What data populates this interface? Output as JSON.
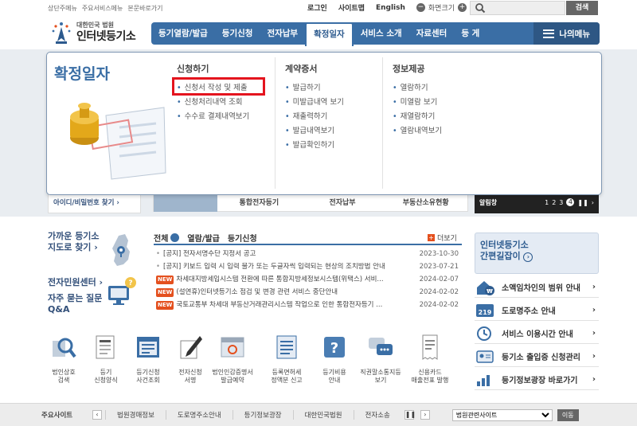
{
  "skip_links": [
    "상단주메뉴",
    "주요서비스메뉴",
    "본문바로가기"
  ],
  "utility": {
    "login": "로그인",
    "sitemap": "사이트맵",
    "english": "English",
    "zoom_label": "화면크기",
    "zoom_minus": "−",
    "zoom_plus": "+"
  },
  "search": {
    "placeholder": "",
    "button": "검색"
  },
  "logo": {
    "small": "대한민국 법원",
    "big": "인터넷등기소"
  },
  "gnb": {
    "items": [
      "등기열람/발급",
      "등기신청",
      "전자납부",
      "확정일자",
      "서비스 소개",
      "자료센터",
      "등 게"
    ],
    "active_index": 3,
    "menu_button": "나의메뉴"
  },
  "dropdown": {
    "title": "확정일자",
    "columns": [
      {
        "heading": "신청하기",
        "items": [
          "신청서 작성 및 제출",
          "신청처리내역 조회",
          "수수료 결제내역보기"
        ]
      },
      {
        "heading": "계약증서",
        "items": [
          "발급하기",
          "미발급내역 보기",
          "재출력하기",
          "발급내역보기",
          "발급확인하기"
        ]
      },
      {
        "heading": "정보제공",
        "items": [
          "열람하기",
          "미열람 보기",
          "재열람하기",
          "열람내역보기"
        ]
      }
    ]
  },
  "background": {
    "login_link": "아이디/비밀번호 찾기 ›",
    "mid_tabs": [
      "통합전자등기",
      "전자납부",
      "부동산소유현황"
    ],
    "banner_label": "알림창",
    "banner_pages": [
      "1",
      "2",
      "3",
      "4"
    ],
    "banner_current": "4",
    "banner_pause": "❚❚",
    "banner_next": "›"
  },
  "quick": {
    "directions": [
      "가까운 등기소",
      "지도로 찾기 ›"
    ],
    "civil_center": "전자민원센터 ›",
    "faq": [
      "자주 묻는 질문",
      "Q&A"
    ]
  },
  "news": {
    "tabs": [
      "전체",
      "열람/발급",
      "등기신청"
    ],
    "more": "더보기",
    "rows": [
      {
        "new": false,
        "title": "[공지] 전자서명수단 지정서 공고",
        "date": "2023-10-30"
      },
      {
        "new": false,
        "title": "[공지] 키보드 입력 시 입력 불가 또는 두글자씩 입력되는 현상의 조치방법 안내",
        "date": "2023-07-21"
      },
      {
        "new": true,
        "title": "차세대지방세입시스템 전환에 따른 통합지방세정보시스템(위택스) 서비...",
        "date": "2024-02-07"
      },
      {
        "new": true,
        "title": "(설연휴)인터넷등기소 점검 및 변경 관련 서비스 중단안내",
        "date": "2024-02-02"
      },
      {
        "new": true,
        "title": "국토교통부 차세대 부동산거래관리시스템 작업으로 인한 통합전자등기 ...",
        "date": "2024-02-02"
      }
    ],
    "new_badge": "NEW"
  },
  "guide": {
    "line1": "인터넷등기소",
    "line2": "간편길잡이",
    "arrow": "›"
  },
  "side_links": [
    "소액임차인의 범위 안내",
    "도로명주소 안내",
    "서비스 이용시간 안내",
    "등기소 출입증 신청관리",
    "등기정보광장 바로가기"
  ],
  "icon_tiles": [
    {
      "icon": "magnifier-building-icon",
      "label": "법인상호\n검색"
    },
    {
      "icon": "document-form-icon",
      "label": "등기\n신청양식"
    },
    {
      "icon": "calendar-list-icon",
      "label": "등기신청\n사건조회"
    },
    {
      "icon": "pen-sign-icon",
      "label": "전자신청\n서명"
    },
    {
      "icon": "seal-calendar-icon",
      "label": "법인인감증명서\n발급예약"
    },
    {
      "icon": "report-document-icon",
      "label": "등록면허세\n정액분 신고"
    },
    {
      "icon": "question-book-icon",
      "label": "등기비용\n안내"
    },
    {
      "icon": "chat-people-icon",
      "label": "직권말소통지등\n보기"
    },
    {
      "icon": "receipt-icon",
      "label": "신용카드\n매출전표 발행"
    }
  ],
  "footer": {
    "label": "주요사이트",
    "sites": [
      "법원경매정보",
      "도로명주소안내",
      "등기정보광장",
      "대한민국법원",
      "전자소송"
    ],
    "select_value": "법원관련사이트",
    "go": "이동"
  },
  "colors": {
    "primary": "#3a6ea5",
    "highlight": "#e4141e",
    "new_badge": "#e4501e"
  }
}
